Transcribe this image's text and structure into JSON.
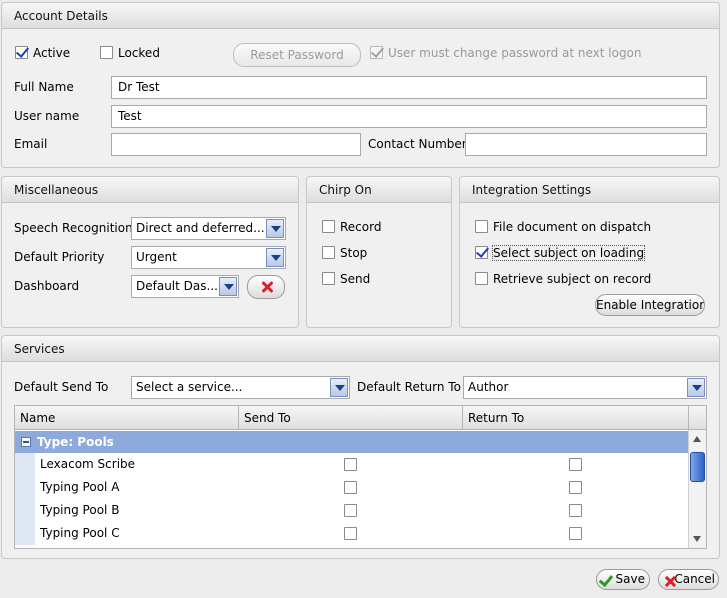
{
  "account": {
    "header": "Account Details",
    "active_label": "Active",
    "locked_label": "Locked",
    "reset_password_label": "Reset Password",
    "must_change_label": "User must change password at next logon",
    "full_name_label": "Full Name",
    "full_name_value": "Dr Test",
    "username_label": "User name",
    "username_value": "Test",
    "email_label": "Email",
    "email_value": "",
    "contact_label": "Contact Number",
    "contact_value": ""
  },
  "misc": {
    "header": "Miscellaneous",
    "speech_label": "Speech Recognition",
    "speech_value": "Direct and deferred...",
    "priority_label": "Default Priority",
    "priority_value": "Urgent",
    "dashboard_label": "Dashboard",
    "dashboard_value": "Default Das..."
  },
  "chirp": {
    "header": "Chirp On",
    "record_label": "Record",
    "stop_label": "Stop",
    "send_label": "Send"
  },
  "integration": {
    "header": "Integration Settings",
    "file_label": "File document on dispatch",
    "select_label": "Select subject on loading",
    "retrieve_label": "Retrieve subject on record",
    "enable_button": "Enable Integration"
  },
  "services": {
    "header": "Services",
    "send_to_label": "Default Send To",
    "send_to_value": "Select a service...",
    "return_to_label": "Default Return To",
    "return_to_value": "Author",
    "columns": [
      "Name",
      "Send To",
      "Return To"
    ],
    "group_label": "Type: Pools",
    "rows": [
      {
        "name": "Lexacom Scribe"
      },
      {
        "name": "Typing Pool A"
      },
      {
        "name": "Typing Pool B"
      },
      {
        "name": "Typing Pool C"
      }
    ]
  },
  "footer": {
    "save_label": "Save",
    "cancel_label": "Cancel"
  }
}
